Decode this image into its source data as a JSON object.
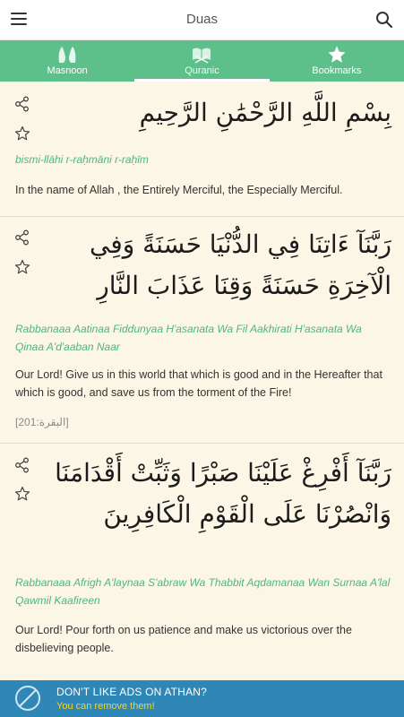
{
  "header": {
    "title": "Duas",
    "menu_icon": "menu-icon",
    "search_icon": "search-icon"
  },
  "tabs": [
    {
      "label": "Masnoon",
      "icon": "hands-icon",
      "active": false
    },
    {
      "label": "Quranic",
      "icon": "quran-icon",
      "active": true
    },
    {
      "label": "Bookmarks",
      "icon": "star-icon",
      "active": false
    }
  ],
  "duas": [
    {
      "arabic": "بِسْمِ اللَّهِ الرَّحْمَٰنِ الرَّحِيمِ",
      "transliteration": "bismi-llāhi r-raḥmāni r-raḥīm",
      "translation": "In the name of Allah , the Entirely Merciful, the Especially Merciful.",
      "reference": ""
    },
    {
      "arabic": "رَبَّنَآ ءَاتِنَا فِي الدُّنْيَا حَسَنَةً وَفِي الْآخِرَةِ حَسَنَةً وَقِنَا عَذَابَ النَّارِ",
      "transliteration": "Rabbanaaa Aatinaa Fiddunyaa H'asanata Wa Fil Aakhirati H'asanata Wa Qinaa A'd'aaban Naar",
      "translation": "Our Lord! Give us in this world that which is good and in the Hereafter that which is good, and save us from the torment of the Fire!",
      "reference": "[البقرة:201]"
    },
    {
      "arabic": "رَبَّنَآ أَفْرِغْ عَلَيْنَا صَبْرًا وَثَبِّتْ أَقْدَامَنَا وَانْصُرْنَا عَلَى الْقَوْمِ الْكَافِرِينَ",
      "transliteration": "Rabbanaaa Afrigh A'laynaa S'abraw Wa Thabbit Aqdamanaa Wan Surnaa A'lal Qawmil Kaafireen",
      "translation": "Our Lord! Pour forth on us patience and make us victorious over the disbelieving people.",
      "reference": ""
    }
  ],
  "ad": {
    "title": "DON'T LIKE ADS ON ATHAN?",
    "subtitle": "You can remove them!",
    "icon": "no-ads-icon"
  },
  "colors": {
    "tab_bar": "#5dc08a",
    "background": "#fbf6e6",
    "transliteration": "#4fb77d",
    "ad_bar": "#2f87b8",
    "ad_link": "#f5d327"
  }
}
